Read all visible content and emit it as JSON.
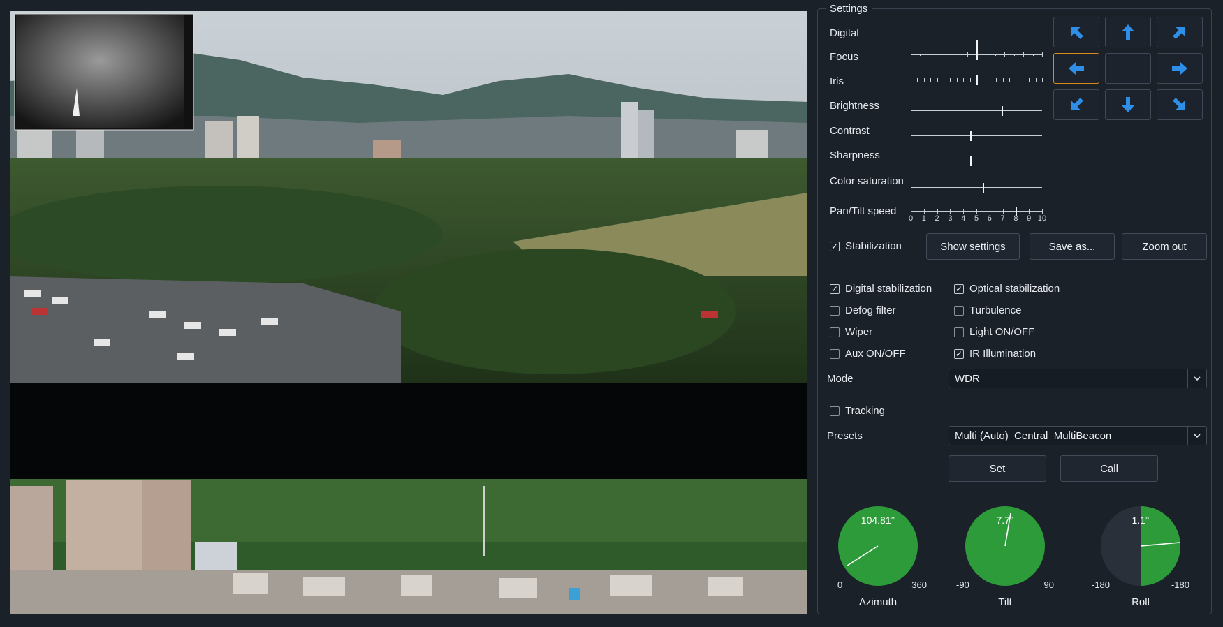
{
  "panel": {
    "legend": "Settings",
    "sliders": [
      {
        "label": "Digital",
        "value": null
      },
      {
        "label": "Focus",
        "value": 0.5
      },
      {
        "label": "Iris",
        "value": 0.5
      },
      {
        "label": "Brightness",
        "value": 0.69
      },
      {
        "label": "Contrast",
        "value": 0.45
      },
      {
        "label": "Sharpness",
        "value": 0.45
      },
      {
        "label": "Color saturation",
        "value": 0.55
      },
      {
        "label": "Pan/Tilt speed",
        "value": 0.8
      }
    ],
    "speed_scale": [
      "0",
      "1",
      "2",
      "3",
      "4",
      "5",
      "6",
      "7",
      "8",
      "9",
      "10"
    ],
    "ptz": {
      "buttons": [
        "up-left",
        "up",
        "up-right",
        "left",
        "center",
        "right",
        "down-left",
        "down",
        "down-right"
      ],
      "active": "left",
      "arrow_color": "#2f8fe8"
    },
    "stabilization": {
      "label": "Stabilization",
      "checked": true
    },
    "actions": {
      "show_settings": "Show settings",
      "save_as": "Save as...",
      "zoom_out": "Zoom out"
    },
    "options_left": [
      {
        "label": "Digital stabilization",
        "checked": true
      },
      {
        "label": "Defog filter",
        "checked": false
      },
      {
        "label": "Wiper",
        "checked": false
      },
      {
        "label": "Aux ON/OFF",
        "checked": false
      }
    ],
    "options_right": [
      {
        "label": "Optical stabilization",
        "checked": true
      },
      {
        "label": "Turbulence",
        "checked": false
      },
      {
        "label": "Light ON/OFF",
        "checked": false
      },
      {
        "label": "IR Illumination",
        "checked": true
      }
    ],
    "mode": {
      "label": "Mode",
      "value": "WDR"
    },
    "tracking": {
      "label": "Tracking",
      "checked": false
    },
    "presets": {
      "label": "Presets",
      "value": "Multi (Auto)_Central_MultiBeacon",
      "set": "Set",
      "call": "Call"
    },
    "dials": [
      {
        "name": "Azimuth",
        "value": "104.81°",
        "lo": "0",
        "hi": "360",
        "deg": 104.81,
        "color": "#2e9b3b"
      },
      {
        "name": "Tilt",
        "value": "7.7°",
        "lo": "-90",
        "hi": "90",
        "deg": 7.7,
        "color": "#2e9b3b"
      },
      {
        "name": "Roll",
        "value": "1.1°",
        "lo": "-180",
        "hi": "-180",
        "deg": 1.1,
        "color": "#2e9b3b"
      }
    ]
  }
}
